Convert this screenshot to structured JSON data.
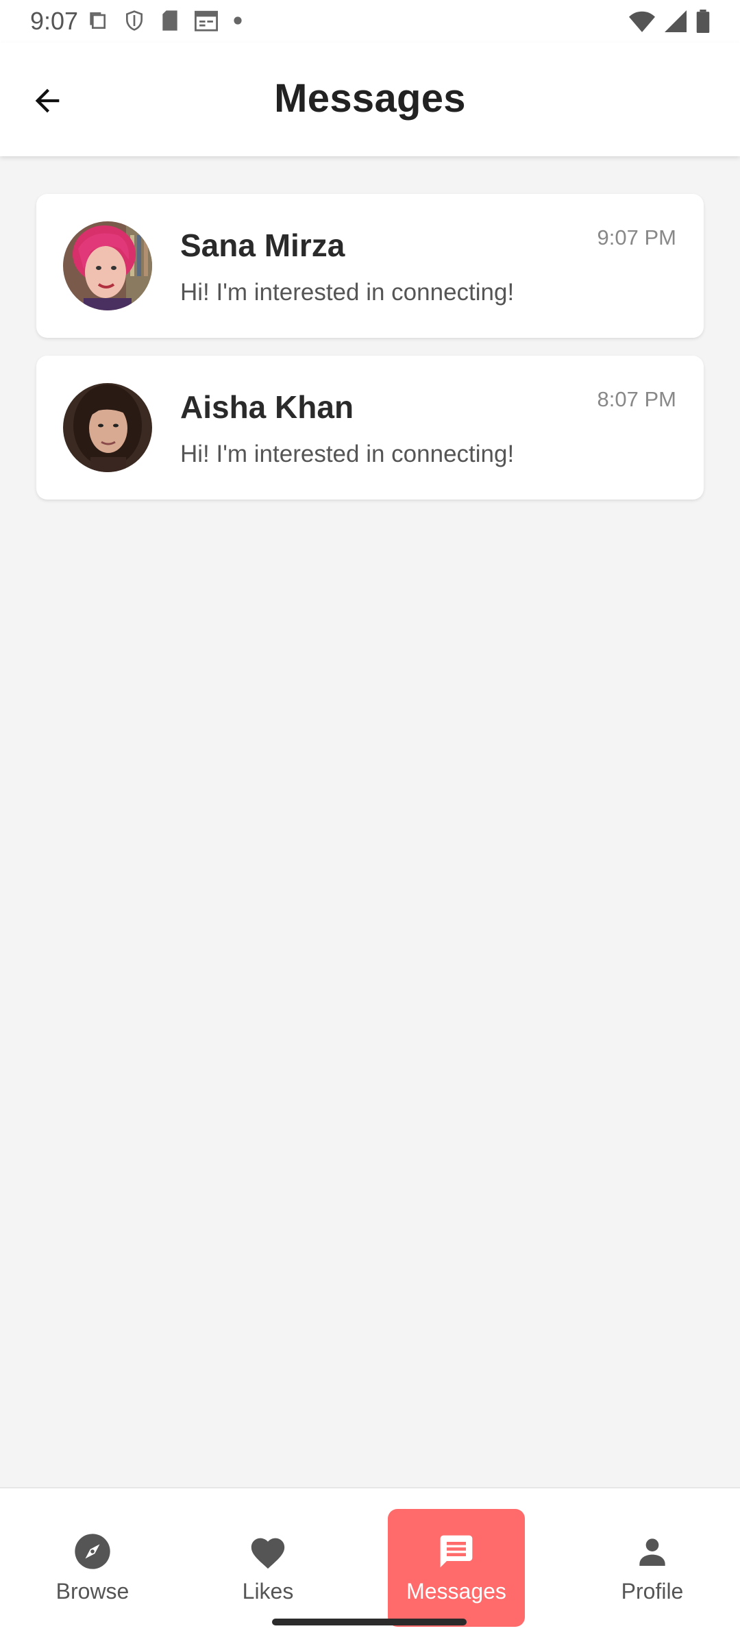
{
  "status_bar": {
    "time": "9:07"
  },
  "header": {
    "title": "Messages",
    "back_icon": "arrow-back-icon"
  },
  "conversations": [
    {
      "name": "Sana Mirza",
      "preview": "Hi! I'm interested in connecting!",
      "time": "9:07 PM"
    },
    {
      "name": "Aisha Khan",
      "preview": "Hi! I'm interested in connecting!",
      "time": "8:07 PM"
    }
  ],
  "bottom_nav": {
    "items": [
      {
        "label": "Browse",
        "icon": "compass-icon"
      },
      {
        "label": "Likes",
        "icon": "heart-icon"
      },
      {
        "label": "Messages",
        "icon": "chat-icon",
        "active": true
      },
      {
        "label": "Profile",
        "icon": "person-icon"
      }
    ]
  },
  "colors": {
    "accent": "#ff6b6b",
    "background": "#f4f4f4",
    "card": "#ffffff"
  }
}
